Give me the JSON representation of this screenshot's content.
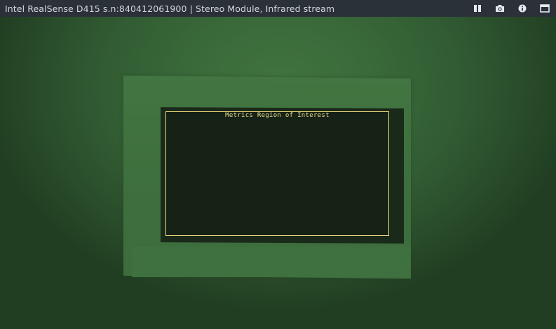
{
  "window": {
    "title": "Intel RealSense D415 s.n:840412061900 | Stereo Module, Infrared stream"
  },
  "toolbar": {
    "buttons": [
      {
        "name": "pause",
        "icon": "pause-icon"
      },
      {
        "name": "snapshot",
        "icon": "camera-icon"
      },
      {
        "name": "info",
        "icon": "info-icon"
      },
      {
        "name": "maximize",
        "icon": "maximize-icon"
      }
    ]
  },
  "stream": {
    "type": "Infrared",
    "roi": {
      "label": "Metrics Region of Interest",
      "border_color": "#e8d57a"
    }
  },
  "colors": {
    "titlebar_bg": "#2a3138",
    "title_text": "#d4d8dc",
    "icon_color": "#e6e9ec",
    "roi_border": "#e8d57a"
  }
}
